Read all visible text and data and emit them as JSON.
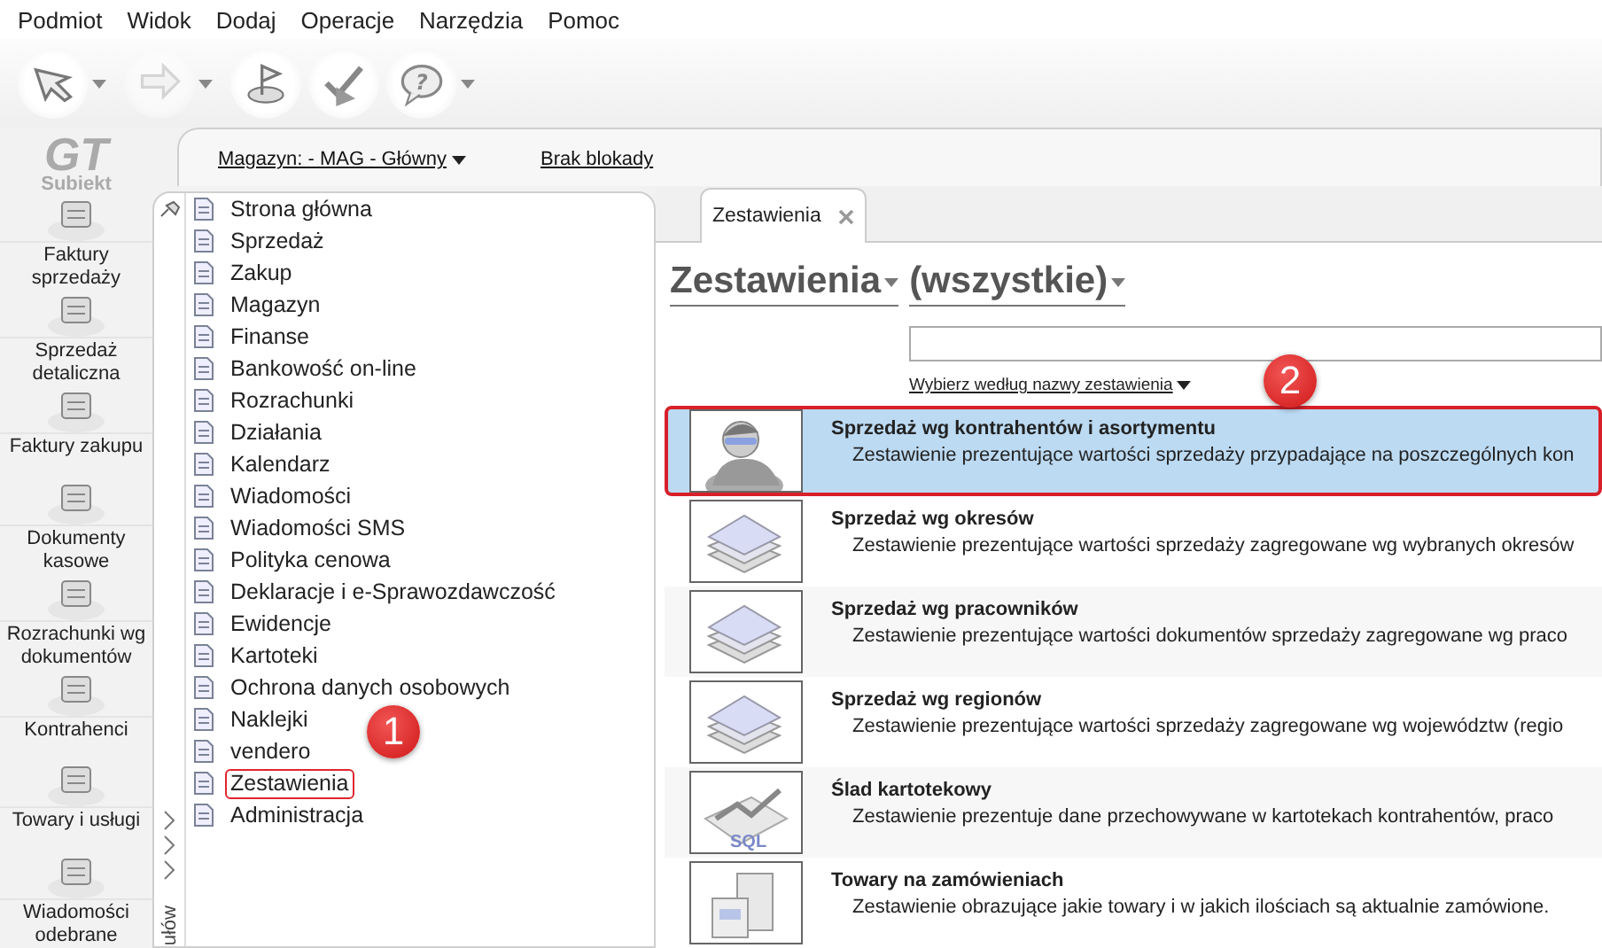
{
  "menu": [
    "Podmiot",
    "Widok",
    "Dodaj",
    "Operacje",
    "Narzędzia",
    "Pomoc"
  ],
  "toolbar": [
    {
      "kind": "cursor",
      "menu": true,
      "disabled": false
    },
    {
      "kind": "arrow",
      "menu": true,
      "disabled": true
    },
    {
      "kind": "flag",
      "menu": false,
      "disabled": false
    },
    {
      "kind": "check",
      "menu": false,
      "disabled": false
    },
    {
      "kind": "help",
      "menu": true,
      "disabled": false,
      "glyph": "?"
    }
  ],
  "logo": {
    "mark": "GT",
    "name": "Subiekt"
  },
  "rail": [
    "Faktury sprzedaży",
    "Sprzedaż detaliczna",
    "Faktury zakupu",
    "Dokumenty kasowe",
    "Rozrachunki wg dokumentów",
    "Kontrahenci",
    "Towary i usługi",
    "Wiadomości odebrane"
  ],
  "rail_caption": "ułów",
  "header": {
    "warehouse": "Magazyn: - MAG - Główny",
    "lock": "Brak blokady"
  },
  "tree": [
    {
      "label": "Strona główna",
      "highlighted": false
    },
    {
      "label": "Sprzedaż",
      "highlighted": false
    },
    {
      "label": "Zakup",
      "highlighted": false
    },
    {
      "label": "Magazyn",
      "highlighted": false
    },
    {
      "label": "Finanse",
      "highlighted": false
    },
    {
      "label": "Bankowość on-line",
      "highlighted": false
    },
    {
      "label": "Rozrachunki",
      "highlighted": false
    },
    {
      "label": "Działania",
      "highlighted": false
    },
    {
      "label": "Kalendarz",
      "highlighted": false
    },
    {
      "label": "Wiadomości",
      "highlighted": false
    },
    {
      "label": "Wiadomości SMS",
      "highlighted": false
    },
    {
      "label": "Polityka cenowa",
      "highlighted": false
    },
    {
      "label": "Deklaracje i e-Sprawozdawczość",
      "highlighted": false
    },
    {
      "label": "Ewidencje",
      "highlighted": false
    },
    {
      "label": "Kartoteki",
      "highlighted": false
    },
    {
      "label": "Ochrona danych osobowych",
      "highlighted": false
    },
    {
      "label": "Naklejki",
      "highlighted": false,
      "badge": "1"
    },
    {
      "label": "vendero",
      "highlighted": false
    },
    {
      "label": "Zestawienia",
      "highlighted": true
    },
    {
      "label": "Administracja",
      "highlighted": false
    }
  ],
  "tab": {
    "label": "Zestawienia"
  },
  "heading": {
    "group": "Zestawienia",
    "filter": "(wszystkie)"
  },
  "search": {
    "hint": "Wybierz według nazwy zestawienia",
    "badge": "2"
  },
  "reports": [
    {
      "kind": "person",
      "title": "Sprzedaż wg kontrahentów i asortymentu",
      "description": "Zestawienie prezentujące wartości sprzedaży przypadające na poszczególnych kon",
      "selected": true,
      "highlighted": true
    },
    {
      "kind": "layers",
      "title": "Sprzedaż wg okresów",
      "description": "Zestawienie prezentujące wartości sprzedaży zagregowane wg wybranych okresów",
      "selected": false,
      "highlighted": false
    },
    {
      "kind": "layers",
      "title": "Sprzedaż wg pracowników",
      "description": "Zestawienie prezentujące wartości dokumentów sprzedaży zagregowane wg praco",
      "selected": false,
      "highlighted": false
    },
    {
      "kind": "layers",
      "title": "Sprzedaż wg regionów",
      "description": "Zestawienie prezentujące wartości sprzedaży zagregowane wg województw (regio",
      "selected": false,
      "highlighted": false
    },
    {
      "kind": "sql",
      "thumb_text": "SQL",
      "title": "Ślad kartotekowy",
      "description": "Zestawienie prezentuje dane przechowywane w kartotekach kontrahentów, praco",
      "selected": false,
      "highlighted": false
    },
    {
      "kind": "boxes",
      "title": "Towary na zamówieniach",
      "description": "Zestawienie obrazujące jakie towary i w jakich ilościach są aktualnie zamówione.",
      "selected": false,
      "highlighted": false
    }
  ]
}
